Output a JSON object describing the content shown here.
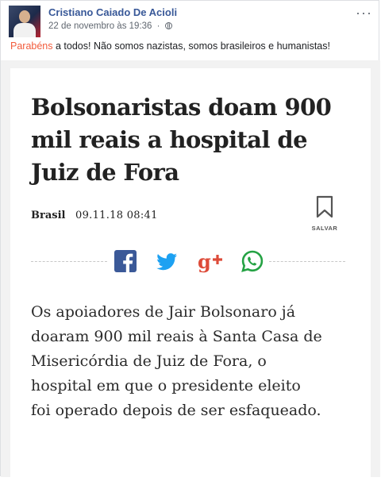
{
  "post": {
    "author": "Cristiano Caiado De Acioli",
    "date": "22 de novembro às 19:36",
    "separator": "·",
    "more_icon": "more-horizontal-icon",
    "privacy_icon": "globe-icon",
    "text_highlight": "Parabéns",
    "text_rest": " a todos! Não somos nazistas, somos brasileiros e humanistas!"
  },
  "article": {
    "headline": "Bolsonaristas doam 900 mil reais a hospital de Juiz de Fora",
    "section": "Brasil",
    "date": "09.11.18 08:41",
    "save_label": "SALVAR",
    "save_icon": "bookmark-icon",
    "share": [
      {
        "name": "facebook-icon",
        "text": "f",
        "color": "#3b5998"
      },
      {
        "name": "twitter-icon",
        "text": "",
        "color": "#1da1f2"
      },
      {
        "name": "google-plus-icon",
        "text": "g+",
        "color": "#dd4b39"
      },
      {
        "name": "whatsapp-icon",
        "text": "",
        "color": "#25a244"
      }
    ],
    "body_lines": [
      "Os apoiadores de Jair Bolsonaro já",
      "doaram 900 mil reais à Santa Casa de",
      "Misericórdia de Juiz de Fora, o",
      "hospital em que o presidente eleito",
      "foi operado depois de ser esfaqueado."
    ]
  },
  "colors": {
    "author_link": "#385898",
    "highlight": "#f25c3c"
  }
}
